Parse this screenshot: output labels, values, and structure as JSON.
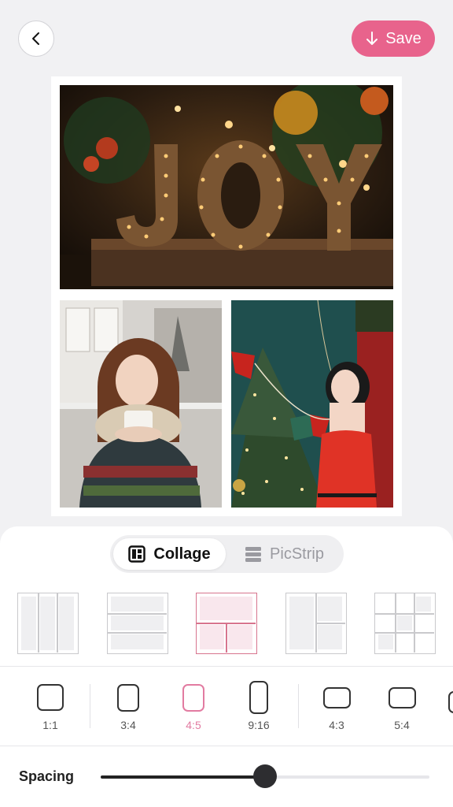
{
  "header": {
    "back_icon": "chevron-left-icon",
    "save_label": "Save",
    "save_icon": "arrow-down-icon",
    "accent_color": "#e8638c"
  },
  "collage": {
    "photos": [
      {
        "description": "joy-marquee-letters"
      },
      {
        "description": "woman-with-mug-sweater"
      },
      {
        "description": "woman-red-dress-christmas-tree"
      }
    ]
  },
  "mode_tabs": {
    "collage": "Collage",
    "picstrip": "PicStrip",
    "active": "Collage"
  },
  "layouts": {
    "selected_index": 2,
    "items": [
      "three-columns",
      "three-rows",
      "one-top-two-bottom",
      "one-left-two-right",
      "grid-mixed"
    ]
  },
  "ratios": {
    "selected": "4:5",
    "items": [
      "1:1",
      "3:4",
      "4:5",
      "9:16",
      "4:3",
      "5:4"
    ]
  },
  "spacing": {
    "label": "Spacing",
    "value": 0.5
  }
}
